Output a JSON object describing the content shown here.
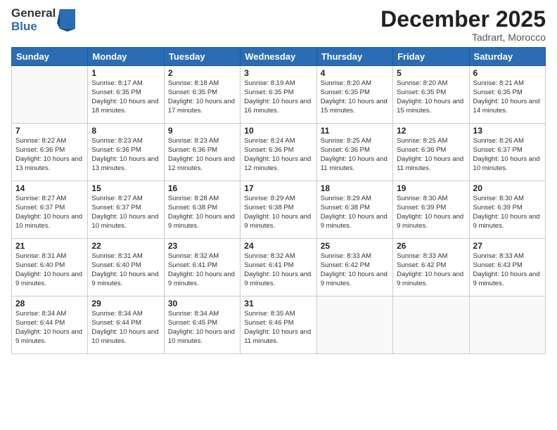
{
  "logo": {
    "general": "General",
    "blue": "Blue"
  },
  "header": {
    "month": "December 2025",
    "location": "Tadrart, Morocco"
  },
  "weekdays": [
    "Sunday",
    "Monday",
    "Tuesday",
    "Wednesday",
    "Thursday",
    "Friday",
    "Saturday"
  ],
  "weeks": [
    [
      {
        "day": "",
        "info": ""
      },
      {
        "day": "1",
        "info": "Sunrise: 8:17 AM\nSunset: 6:35 PM\nDaylight: 10 hours\nand 18 minutes."
      },
      {
        "day": "2",
        "info": "Sunrise: 8:18 AM\nSunset: 6:35 PM\nDaylight: 10 hours\nand 17 minutes."
      },
      {
        "day": "3",
        "info": "Sunrise: 8:19 AM\nSunset: 6:35 PM\nDaylight: 10 hours\nand 16 minutes."
      },
      {
        "day": "4",
        "info": "Sunrise: 8:20 AM\nSunset: 6:35 PM\nDaylight: 10 hours\nand 15 minutes."
      },
      {
        "day": "5",
        "info": "Sunrise: 8:20 AM\nSunset: 6:35 PM\nDaylight: 10 hours\nand 15 minutes."
      },
      {
        "day": "6",
        "info": "Sunrise: 8:21 AM\nSunset: 6:35 PM\nDaylight: 10 hours\nand 14 minutes."
      }
    ],
    [
      {
        "day": "7",
        "info": "Sunrise: 8:22 AM\nSunset: 6:36 PM\nDaylight: 10 hours\nand 13 minutes."
      },
      {
        "day": "8",
        "info": "Sunrise: 8:23 AM\nSunset: 6:36 PM\nDaylight: 10 hours\nand 13 minutes."
      },
      {
        "day": "9",
        "info": "Sunrise: 8:23 AM\nSunset: 6:36 PM\nDaylight: 10 hours\nand 12 minutes."
      },
      {
        "day": "10",
        "info": "Sunrise: 8:24 AM\nSunset: 6:36 PM\nDaylight: 10 hours\nand 12 minutes."
      },
      {
        "day": "11",
        "info": "Sunrise: 8:25 AM\nSunset: 6:36 PM\nDaylight: 10 hours\nand 11 minutes."
      },
      {
        "day": "12",
        "info": "Sunrise: 8:25 AM\nSunset: 6:36 PM\nDaylight: 10 hours\nand 11 minutes."
      },
      {
        "day": "13",
        "info": "Sunrise: 8:26 AM\nSunset: 6:37 PM\nDaylight: 10 hours\nand 10 minutes."
      }
    ],
    [
      {
        "day": "14",
        "info": "Sunrise: 8:27 AM\nSunset: 6:37 PM\nDaylight: 10 hours\nand 10 minutes."
      },
      {
        "day": "15",
        "info": "Sunrise: 8:27 AM\nSunset: 6:37 PM\nDaylight: 10 hours\nand 10 minutes."
      },
      {
        "day": "16",
        "info": "Sunrise: 8:28 AM\nSunset: 6:38 PM\nDaylight: 10 hours\nand 9 minutes."
      },
      {
        "day": "17",
        "info": "Sunrise: 8:29 AM\nSunset: 6:38 PM\nDaylight: 10 hours\nand 9 minutes."
      },
      {
        "day": "18",
        "info": "Sunrise: 8:29 AM\nSunset: 6:38 PM\nDaylight: 10 hours\nand 9 minutes."
      },
      {
        "day": "19",
        "info": "Sunrise: 8:30 AM\nSunset: 6:39 PM\nDaylight: 10 hours\nand 9 minutes."
      },
      {
        "day": "20",
        "info": "Sunrise: 8:30 AM\nSunset: 6:39 PM\nDaylight: 10 hours\nand 9 minutes."
      }
    ],
    [
      {
        "day": "21",
        "info": "Sunrise: 8:31 AM\nSunset: 6:40 PM\nDaylight: 10 hours\nand 9 minutes."
      },
      {
        "day": "22",
        "info": "Sunrise: 8:31 AM\nSunset: 6:40 PM\nDaylight: 10 hours\nand 9 minutes."
      },
      {
        "day": "23",
        "info": "Sunrise: 8:32 AM\nSunset: 6:41 PM\nDaylight: 10 hours\nand 9 minutes."
      },
      {
        "day": "24",
        "info": "Sunrise: 8:32 AM\nSunset: 6:41 PM\nDaylight: 10 hours\nand 9 minutes."
      },
      {
        "day": "25",
        "info": "Sunrise: 8:33 AM\nSunset: 6:42 PM\nDaylight: 10 hours\nand 9 minutes."
      },
      {
        "day": "26",
        "info": "Sunrise: 8:33 AM\nSunset: 6:42 PM\nDaylight: 10 hours\nand 9 minutes."
      },
      {
        "day": "27",
        "info": "Sunrise: 8:33 AM\nSunset: 6:43 PM\nDaylight: 10 hours\nand 9 minutes."
      }
    ],
    [
      {
        "day": "28",
        "info": "Sunrise: 8:34 AM\nSunset: 6:44 PM\nDaylight: 10 hours\nand 9 minutes."
      },
      {
        "day": "29",
        "info": "Sunrise: 8:34 AM\nSunset: 6:44 PM\nDaylight: 10 hours\nand 10 minutes."
      },
      {
        "day": "30",
        "info": "Sunrise: 8:34 AM\nSunset: 6:45 PM\nDaylight: 10 hours\nand 10 minutes."
      },
      {
        "day": "31",
        "info": "Sunrise: 8:35 AM\nSunset: 6:46 PM\nDaylight: 10 hours\nand 11 minutes."
      },
      {
        "day": "",
        "info": ""
      },
      {
        "day": "",
        "info": ""
      },
      {
        "day": "",
        "info": ""
      }
    ]
  ]
}
